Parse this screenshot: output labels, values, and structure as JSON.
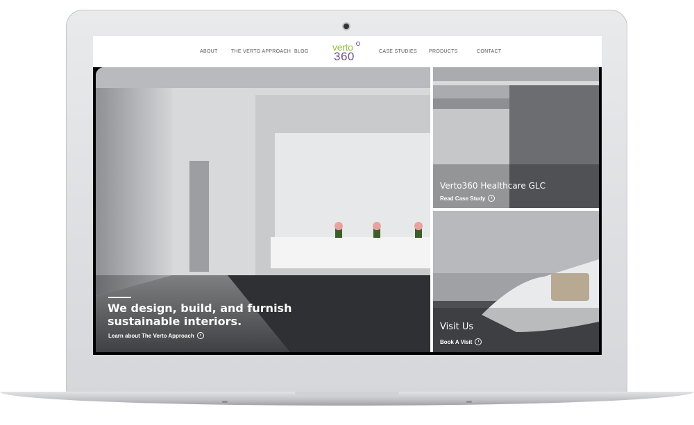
{
  "nav": {
    "items": [
      {
        "label": "ABOUT"
      },
      {
        "label": "THE VERTO APPROACH"
      },
      {
        "label": "BLOG"
      },
      {
        "label": "CASE STUDIES"
      },
      {
        "label": "PRODUCTS"
      },
      {
        "label": "CONTACT"
      }
    ],
    "logo": {
      "top": "verto",
      "bottom": "360"
    }
  },
  "hero": {
    "main": {
      "headline_line1": "We design, build, and furnish",
      "headline_line2": "sustainable interiors.",
      "link": "Learn about The Verto Approach"
    },
    "side_top": {
      "title": "Verto360 Healthcare GLC",
      "link": "Read Case Study"
    },
    "side_bottom": {
      "title": "Visit Us",
      "link": "Book A Visit"
    }
  },
  "colors": {
    "logo_green": "#8cc63f",
    "logo_purple": "#6b4d8f"
  }
}
